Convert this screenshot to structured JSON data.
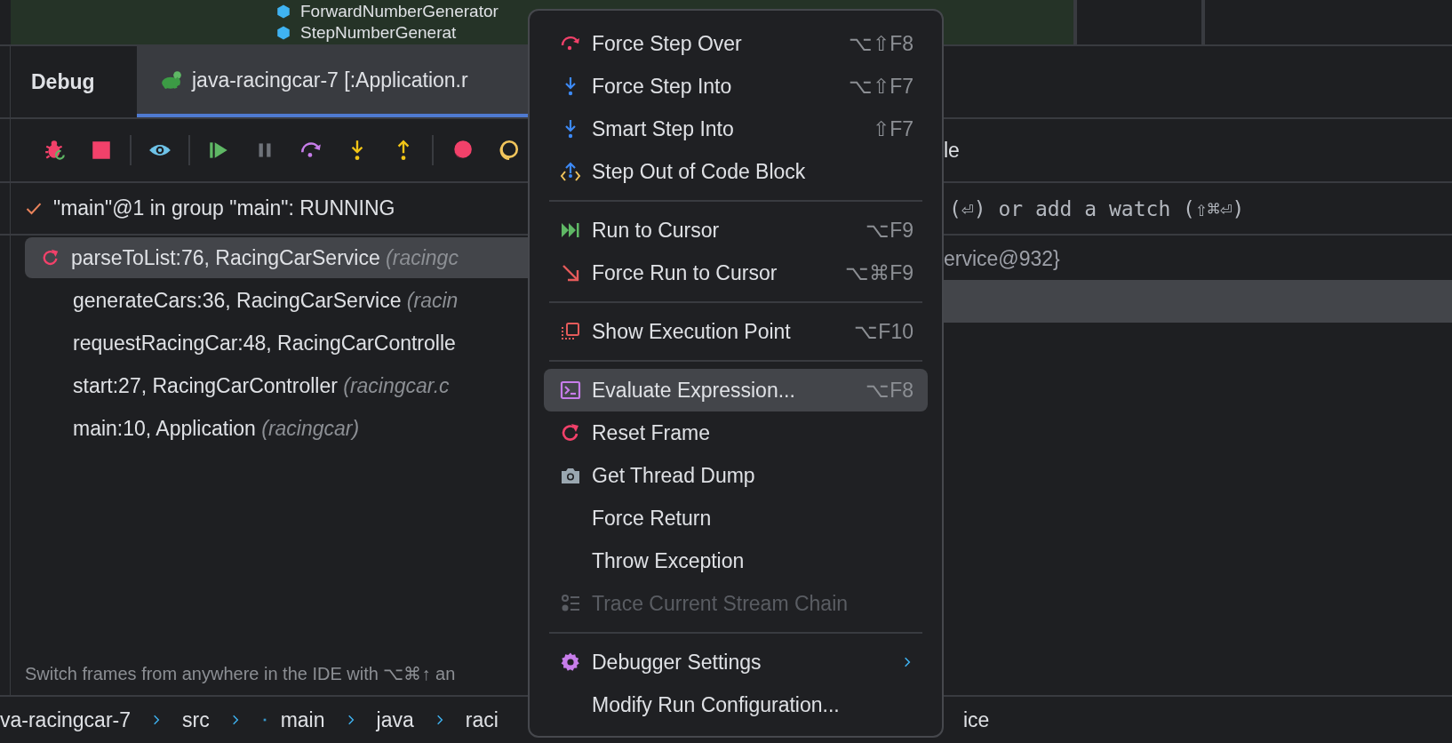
{
  "project_tree": {
    "items": [
      {
        "label": "ForwardNumberGenerator"
      },
      {
        "label": "StepNumberGenerat"
      }
    ]
  },
  "debug_panel": {
    "title": "Debug",
    "tabs": [
      {
        "label": "java-racingcar-7 [:Application.r",
        "selected": true
      }
    ],
    "thread": {
      "label": "\"main\"@1 in group \"main\": RUNNING"
    },
    "frames": [
      {
        "method": "parseToList:76, RacingCarService",
        "package": "(racingc",
        "selected": true
      },
      {
        "method": "generateCars:36, RacingCarService",
        "package": "(racin",
        "selected": false
      },
      {
        "method": "requestRacingCar:48, RacingCarControlle",
        "selected": false
      },
      {
        "method": "start:27, RacingCarController",
        "package": "(racingcar.c",
        "selected": false
      },
      {
        "method": "main:10, Application",
        "package": "(racingcar)",
        "selected": false
      }
    ],
    "hint": "Switch frames from anywhere in the IDE with ⌥⌘↑ an"
  },
  "variables_panel": {
    "tab": "le",
    "watch_hint": "(⏎) or add a watch (⇧⌘⏎)",
    "rows": [
      {
        "value": "ervice@932}",
        "selected": false
      },
      {
        "selected": true
      }
    ]
  },
  "breadcrumbs": [
    {
      "label": "va-racingcar-7",
      "kind": "folder"
    },
    {
      "label": "src",
      "kind": "folder"
    },
    {
      "label": "main",
      "kind": "module"
    },
    {
      "label": "java",
      "kind": "folder"
    },
    {
      "label": "raci",
      "kind": "folder"
    }
  ],
  "breadcrumb_tail": "ice",
  "context_menu": {
    "groups": [
      {
        "items": [
          {
            "label": "Force Step Over",
            "shortcut": "⌥⇧F8",
            "selected": false,
            "disabled": false,
            "submenu": false
          },
          {
            "label": "Force Step Into",
            "shortcut": "⌥⇧F7",
            "selected": false,
            "disabled": false,
            "submenu": false
          },
          {
            "label": "Smart Step Into",
            "shortcut": "⇧F7",
            "selected": false,
            "disabled": false,
            "submenu": false
          },
          {
            "label": "Step Out of Code Block",
            "selected": false,
            "disabled": false,
            "submenu": false
          }
        ]
      },
      {
        "items": [
          {
            "label": "Run to Cursor",
            "shortcut": "⌥F9",
            "selected": false,
            "disabled": false,
            "submenu": false
          },
          {
            "label": "Force Run to Cursor",
            "shortcut": "⌥⌘F9",
            "selected": false,
            "disabled": false,
            "submenu": false
          }
        ]
      },
      {
        "items": [
          {
            "label": "Show Execution Point",
            "shortcut": "⌥F10",
            "selected": false,
            "disabled": false,
            "submenu": false
          }
        ]
      },
      {
        "items": [
          {
            "label": "Evaluate Expression...",
            "shortcut": "⌥F8",
            "selected": true,
            "disabled": false,
            "submenu": false
          },
          {
            "label": "Reset Frame",
            "selected": false,
            "disabled": false,
            "submenu": false
          },
          {
            "label": "Get Thread Dump",
            "selected": false,
            "disabled": false,
            "submenu": false
          },
          {
            "label": "Force Return",
            "selected": false,
            "disabled": false,
            "submenu": false
          },
          {
            "label": "Throw Exception",
            "selected": false,
            "disabled": false,
            "submenu": false
          },
          {
            "label": "Trace Current Stream Chain",
            "selected": false,
            "disabled": true,
            "submenu": false
          }
        ]
      },
      {
        "items": [
          {
            "label": "Debugger Settings",
            "selected": false,
            "disabled": false,
            "submenu": true
          },
          {
            "label": "Modify Run Configuration...",
            "selected": false,
            "disabled": false,
            "submenu": false
          }
        ]
      }
    ]
  }
}
